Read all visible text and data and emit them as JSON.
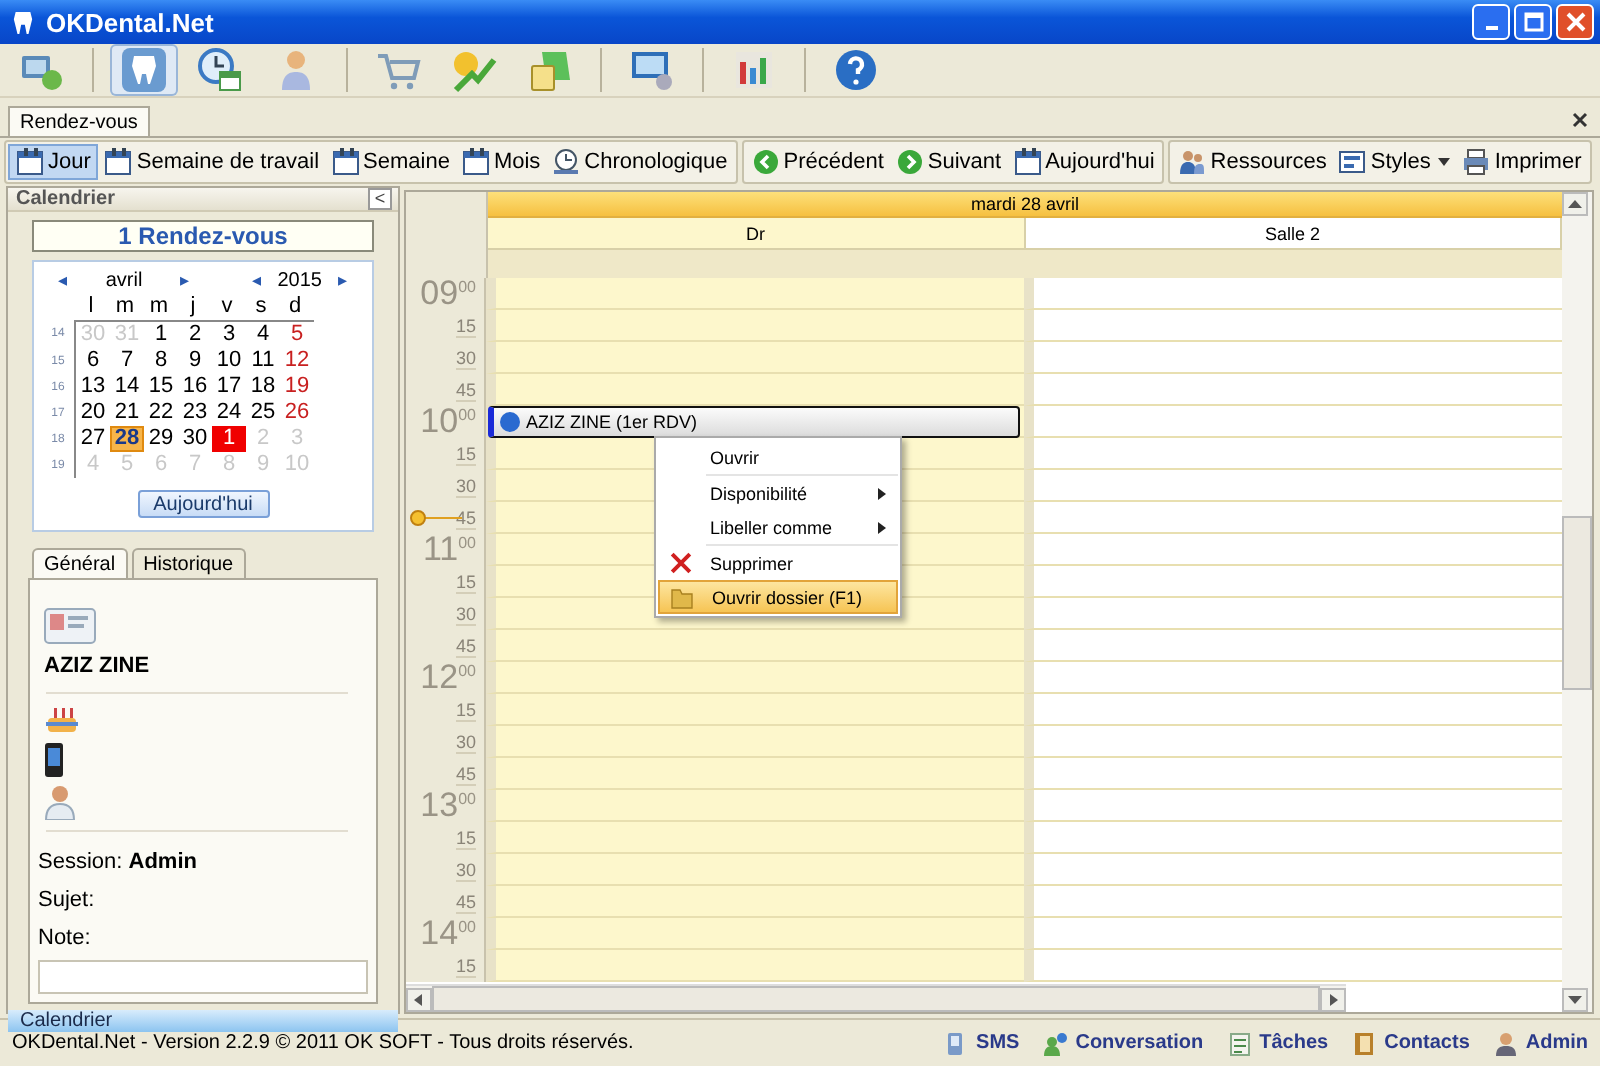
{
  "window": {
    "title": "OKDental.Net"
  },
  "app_toolbar": [
    [
      {
        "selected": false
      }
    ],
    [
      {
        "selected": true
      },
      {
        "selected": false
      },
      {
        "selected": false
      }
    ],
    [
      {
        "selected": false
      },
      {
        "selected": false
      },
      {
        "selected": false
      }
    ],
    [
      {
        "selected": false
      }
    ],
    [
      {
        "selected": false
      }
    ],
    [
      {
        "selected": false
      }
    ]
  ],
  "document_tabs": [
    {
      "label": "Rendez-vous",
      "selected": true
    }
  ],
  "view_toolbar": [
    [
      {
        "label": "Jour",
        "selected": true,
        "dropdown": false
      },
      {
        "label": "Semaine de travail",
        "selected": false,
        "dropdown": false
      },
      {
        "label": "Semaine",
        "selected": false,
        "dropdown": false
      },
      {
        "label": "Mois",
        "selected": false,
        "dropdown": false
      },
      {
        "label": "Chronologique",
        "selected": false,
        "dropdown": false
      }
    ],
    [
      {
        "label": "Précédent",
        "selected": false,
        "dropdown": false
      },
      {
        "label": "Suivant",
        "selected": false,
        "dropdown": false
      },
      {
        "label": "Aujourd'hui",
        "selected": false,
        "dropdown": false
      }
    ],
    [
      {
        "label": "Ressources",
        "selected": false,
        "dropdown": false
      },
      {
        "label": "Styles",
        "selected": false,
        "dropdown": true
      },
      {
        "label": "Imprimer",
        "selected": false,
        "dropdown": false
      }
    ]
  ],
  "calendar_panel": {
    "title": "Calendrier",
    "collapse": "<",
    "summary": "1 Rendez-vous",
    "prev": "◂",
    "month": "avril",
    "next": "▸",
    "year_prev": "◂",
    "year": "2015",
    "year_next": "▸",
    "weekdays": [
      "l",
      "m",
      "m",
      "j",
      "v",
      "s",
      "d"
    ],
    "weeks": [
      {
        "number": "14",
        "days": [
          {
            "d": "30",
            "muted": true,
            "selected": false,
            "marked": false
          },
          {
            "d": "31",
            "muted": true,
            "selected": false,
            "marked": false
          },
          {
            "d": "1",
            "muted": false,
            "selected": false,
            "marked": false
          },
          {
            "d": "2",
            "muted": false,
            "selected": false,
            "marked": false
          },
          {
            "d": "3",
            "muted": false,
            "selected": false,
            "marked": false
          },
          {
            "d": "4",
            "muted": false,
            "selected": false,
            "marked": false
          },
          {
            "d": "5",
            "muted": false,
            "selected": false,
            "marked": false
          }
        ]
      },
      {
        "number": "15",
        "days": [
          {
            "d": "6",
            "muted": false,
            "selected": false,
            "marked": false
          },
          {
            "d": "7",
            "muted": false,
            "selected": false,
            "marked": false
          },
          {
            "d": "8",
            "muted": false,
            "selected": false,
            "marked": false
          },
          {
            "d": "9",
            "muted": false,
            "selected": false,
            "marked": false
          },
          {
            "d": "10",
            "muted": false,
            "selected": false,
            "marked": false
          },
          {
            "d": "11",
            "muted": false,
            "selected": false,
            "marked": false
          },
          {
            "d": "12",
            "muted": false,
            "selected": false,
            "marked": false
          }
        ]
      },
      {
        "number": "16",
        "days": [
          {
            "d": "13",
            "muted": false,
            "selected": false,
            "marked": false
          },
          {
            "d": "14",
            "muted": false,
            "selected": false,
            "marked": false
          },
          {
            "d": "15",
            "muted": false,
            "selected": false,
            "marked": false
          },
          {
            "d": "16",
            "muted": false,
            "selected": false,
            "marked": false
          },
          {
            "d": "17",
            "muted": false,
            "selected": false,
            "marked": false
          },
          {
            "d": "18",
            "muted": false,
            "selected": false,
            "marked": false
          },
          {
            "d": "19",
            "muted": false,
            "selected": false,
            "marked": false
          }
        ]
      },
      {
        "number": "17",
        "days": [
          {
            "d": "20",
            "muted": false,
            "selected": false,
            "marked": false
          },
          {
            "d": "21",
            "muted": false,
            "selected": false,
            "marked": false
          },
          {
            "d": "22",
            "muted": false,
            "selected": false,
            "marked": false
          },
          {
            "d": "23",
            "muted": false,
            "selected": false,
            "marked": false
          },
          {
            "d": "24",
            "muted": false,
            "selected": false,
            "marked": false
          },
          {
            "d": "25",
            "muted": false,
            "selected": false,
            "marked": false
          },
          {
            "d": "26",
            "muted": false,
            "selected": false,
            "marked": false
          }
        ]
      },
      {
        "number": "18",
        "days": [
          {
            "d": "27",
            "muted": false,
            "selected": false,
            "marked": false
          },
          {
            "d": "28",
            "muted": false,
            "selected": true,
            "marked": false
          },
          {
            "d": "29",
            "muted": false,
            "selected": false,
            "marked": false
          },
          {
            "d": "30",
            "muted": false,
            "selected": false,
            "marked": false
          },
          {
            "d": "1",
            "muted": false,
            "selected": false,
            "marked": true
          },
          {
            "d": "2",
            "muted": true,
            "selected": false,
            "marked": false
          },
          {
            "d": "3",
            "muted": true,
            "selected": false,
            "marked": false
          }
        ]
      },
      {
        "number": "19",
        "days": [
          {
            "d": "4",
            "muted": true,
            "selected": false,
            "marked": false
          },
          {
            "d": "5",
            "muted": true,
            "selected": false,
            "marked": false
          },
          {
            "d": "6",
            "muted": true,
            "selected": false,
            "marked": false
          },
          {
            "d": "7",
            "muted": true,
            "selected": false,
            "marked": false
          },
          {
            "d": "8",
            "muted": true,
            "selected": false,
            "marked": false
          },
          {
            "d": "9",
            "muted": true,
            "selected": false,
            "marked": false
          },
          {
            "d": "10",
            "muted": true,
            "selected": false,
            "marked": false
          }
        ]
      }
    ],
    "today_button": "Aujourd'hui"
  },
  "detail_tabs": [
    {
      "label": "Général",
      "selected": true
    },
    {
      "label": "Historique",
      "selected": false
    }
  ],
  "details": {
    "name": "AZIZ ZINE",
    "session": "Session: **Admin**",
    "subject_label": "Sujet:",
    "note_label": "Note:"
  },
  "navigation_bar": {
    "label": "Calendrier"
  },
  "scheduler": {
    "date": "mardi 28 avril",
    "resources": [
      {
        "name": "Dr",
        "color": "#fdf7cc"
      },
      {
        "name": "Salle 2",
        "color": "#ffffff"
      }
    ],
    "hours": [
      {
        "hour": "09",
        "minutes": "00",
        "quarters": [
          {
            "label": "15",
            "current": false
          },
          {
            "label": "30",
            "current": false
          },
          {
            "label": "45",
            "current": false
          }
        ]
      },
      {
        "hour": "10",
        "minutes": "00",
        "appointment": {
          "title": "AZIZ ZINE (1er RDV)"
        },
        "quarters": [
          {
            "label": "15",
            "current": false
          },
          {
            "label": "30",
            "current": false
          },
          {
            "label": "45",
            "current": true
          }
        ]
      },
      {
        "hour": "11",
        "minutes": "00",
        "quarters": [
          {
            "label": "15",
            "current": false
          },
          {
            "label": "30",
            "current": false
          },
          {
            "label": "45",
            "current": false
          }
        ]
      },
      {
        "hour": "12",
        "minutes": "00",
        "quarters": [
          {
            "label": "15",
            "current": false
          },
          {
            "label": "30",
            "current": false
          },
          {
            "label": "45",
            "current": false
          }
        ]
      },
      {
        "hour": "13",
        "minutes": "00",
        "quarters": [
          {
            "label": "15",
            "current": false
          },
          {
            "label": "30",
            "current": false
          },
          {
            "label": "45",
            "current": false
          }
        ]
      },
      {
        "hour": "14",
        "minutes": "00",
        "quarters": [
          {
            "label": "15",
            "current": false
          }
        ]
      }
    ]
  },
  "context_menu": [
    {
      "label": "Ouvrir",
      "submenu": false,
      "selected": false,
      "kind": "plain"
    },
    {
      "label": "Disponibilité",
      "submenu": true,
      "selected": false,
      "kind": "plain"
    },
    {
      "label": "Libeller comme",
      "submenu": true,
      "selected": false,
      "kind": "plain"
    },
    {
      "label": "Supprimer",
      "submenu": false,
      "selected": false,
      "kind": "delete"
    },
    {
      "label": "Ouvrir dossier (F1)",
      "submenu": false,
      "selected": true,
      "kind": "folder"
    }
  ],
  "status_bar": {
    "text": "OKDental.Net - Version 2.2.9 © 2011 OK SOFT - Tous droits réservés.",
    "items": [
      {
        "label": "SMS"
      },
      {
        "label": "Conversation"
      },
      {
        "label": "Tâches"
      },
      {
        "label": "Contacts"
      },
      {
        "label": "Admin"
      }
    ]
  }
}
